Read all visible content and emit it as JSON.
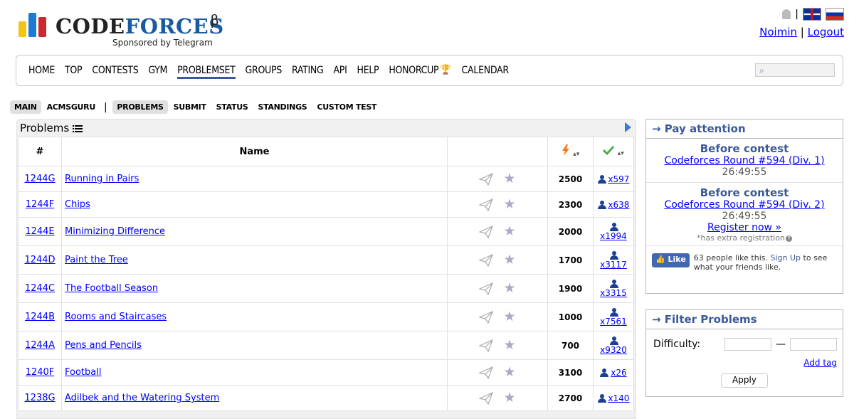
{
  "header": {
    "logo_code": "CODE",
    "logo_forces": "FORCES",
    "logo_beta": "β",
    "sponsor": "Sponsored by Telegram",
    "user": "Noimin",
    "logout": "Logout",
    "separator": "|",
    "logo_bar_colors": [
      "#f3c316",
      "#1c7ad1",
      "#c9292f"
    ]
  },
  "menu": {
    "items": [
      "HOME",
      "TOP",
      "CONTESTS",
      "GYM",
      "PROBLEMSET",
      "GROUPS",
      "RATING",
      "API",
      "HELP",
      "HONORCUP",
      "CALENDAR"
    ],
    "active": "PROBLEMSET",
    "search_placeholder": ""
  },
  "submenu": {
    "items": [
      "MAIN",
      "ACMSGURU",
      "PROBLEMS",
      "SUBMIT",
      "STATUS",
      "STANDINGS",
      "CUSTOM TEST"
    ],
    "selected": [
      "MAIN",
      "PROBLEMS"
    ]
  },
  "problems": {
    "title": "Problems",
    "col_id": "#",
    "col_name": "Name",
    "rows": [
      {
        "id": "1244G",
        "name": "Running in Pairs",
        "difficulty": "2500",
        "solved": "x597",
        "stacked": false
      },
      {
        "id": "1244F",
        "name": "Chips",
        "difficulty": "2300",
        "solved": "x638",
        "stacked": false
      },
      {
        "id": "1244E",
        "name": "Minimizing Difference",
        "difficulty": "2000",
        "solved": "x1994",
        "stacked": true
      },
      {
        "id": "1244D",
        "name": "Paint the Tree",
        "difficulty": "1700",
        "solved": "x3117",
        "stacked": true
      },
      {
        "id": "1244C",
        "name": "The Football Season",
        "difficulty": "1900",
        "solved": "x3315",
        "stacked": true
      },
      {
        "id": "1244B",
        "name": "Rooms and Staircases",
        "difficulty": "1000",
        "solved": "x7561",
        "stacked": true
      },
      {
        "id": "1244A",
        "name": "Pens and Pencils",
        "difficulty": "700",
        "solved": "x9320",
        "stacked": true
      },
      {
        "id": "1240F",
        "name": "Football",
        "difficulty": "3100",
        "solved": "x26",
        "stacked": false
      },
      {
        "id": "1238G",
        "name": "Adilbek and the Watering System",
        "difficulty": "2700",
        "solved": "x140",
        "stacked": false
      }
    ]
  },
  "pay_attention": {
    "title": "→ Pay attention",
    "contests": [
      {
        "label": "Before contest",
        "name": "Codeforces Round #594 (Div. 1)",
        "timer": "26:49:55"
      },
      {
        "label": "Before contest",
        "name": "Codeforces Round #594 (Div. 2)",
        "timer": "26:49:55",
        "register": "Register now »",
        "extra": "*has extra registration"
      }
    ],
    "fb_like": "Like",
    "fb_text_pre": "63 people like this.",
    "fb_signup": "Sign Up",
    "fb_text_post": "to see what your friends like."
  },
  "filter": {
    "title": "→ Filter Problems",
    "difficulty_label": "Difficulty:",
    "dash": "—",
    "add_tag": "Add tag",
    "apply": "Apply"
  }
}
